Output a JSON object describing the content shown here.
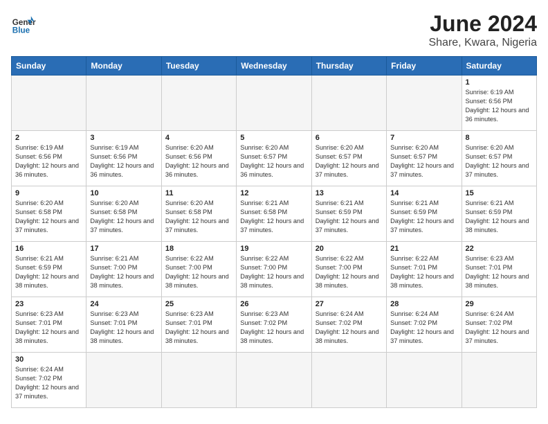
{
  "header": {
    "logo_general": "General",
    "logo_blue": "Blue",
    "title": "June 2024",
    "subtitle": "Share, Kwara, Nigeria"
  },
  "weekdays": [
    "Sunday",
    "Monday",
    "Tuesday",
    "Wednesday",
    "Thursday",
    "Friday",
    "Saturday"
  ],
  "weeks": [
    [
      {
        "day": "",
        "info": ""
      },
      {
        "day": "",
        "info": ""
      },
      {
        "day": "",
        "info": ""
      },
      {
        "day": "",
        "info": ""
      },
      {
        "day": "",
        "info": ""
      },
      {
        "day": "",
        "info": ""
      },
      {
        "day": "1",
        "info": "Sunrise: 6:19 AM\nSunset: 6:56 PM\nDaylight: 12 hours and 36 minutes."
      }
    ],
    [
      {
        "day": "2",
        "info": "Sunrise: 6:19 AM\nSunset: 6:56 PM\nDaylight: 12 hours and 36 minutes."
      },
      {
        "day": "3",
        "info": "Sunrise: 6:19 AM\nSunset: 6:56 PM\nDaylight: 12 hours and 36 minutes."
      },
      {
        "day": "4",
        "info": "Sunrise: 6:20 AM\nSunset: 6:56 PM\nDaylight: 12 hours and 36 minutes."
      },
      {
        "day": "5",
        "info": "Sunrise: 6:20 AM\nSunset: 6:57 PM\nDaylight: 12 hours and 36 minutes."
      },
      {
        "day": "6",
        "info": "Sunrise: 6:20 AM\nSunset: 6:57 PM\nDaylight: 12 hours and 37 minutes."
      },
      {
        "day": "7",
        "info": "Sunrise: 6:20 AM\nSunset: 6:57 PM\nDaylight: 12 hours and 37 minutes."
      },
      {
        "day": "8",
        "info": "Sunrise: 6:20 AM\nSunset: 6:57 PM\nDaylight: 12 hours and 37 minutes."
      }
    ],
    [
      {
        "day": "9",
        "info": "Sunrise: 6:20 AM\nSunset: 6:58 PM\nDaylight: 12 hours and 37 minutes."
      },
      {
        "day": "10",
        "info": "Sunrise: 6:20 AM\nSunset: 6:58 PM\nDaylight: 12 hours and 37 minutes."
      },
      {
        "day": "11",
        "info": "Sunrise: 6:20 AM\nSunset: 6:58 PM\nDaylight: 12 hours and 37 minutes."
      },
      {
        "day": "12",
        "info": "Sunrise: 6:21 AM\nSunset: 6:58 PM\nDaylight: 12 hours and 37 minutes."
      },
      {
        "day": "13",
        "info": "Sunrise: 6:21 AM\nSunset: 6:59 PM\nDaylight: 12 hours and 37 minutes."
      },
      {
        "day": "14",
        "info": "Sunrise: 6:21 AM\nSunset: 6:59 PM\nDaylight: 12 hours and 37 minutes."
      },
      {
        "day": "15",
        "info": "Sunrise: 6:21 AM\nSunset: 6:59 PM\nDaylight: 12 hours and 38 minutes."
      }
    ],
    [
      {
        "day": "16",
        "info": "Sunrise: 6:21 AM\nSunset: 6:59 PM\nDaylight: 12 hours and 38 minutes."
      },
      {
        "day": "17",
        "info": "Sunrise: 6:21 AM\nSunset: 7:00 PM\nDaylight: 12 hours and 38 minutes."
      },
      {
        "day": "18",
        "info": "Sunrise: 6:22 AM\nSunset: 7:00 PM\nDaylight: 12 hours and 38 minutes."
      },
      {
        "day": "19",
        "info": "Sunrise: 6:22 AM\nSunset: 7:00 PM\nDaylight: 12 hours and 38 minutes."
      },
      {
        "day": "20",
        "info": "Sunrise: 6:22 AM\nSunset: 7:00 PM\nDaylight: 12 hours and 38 minutes."
      },
      {
        "day": "21",
        "info": "Sunrise: 6:22 AM\nSunset: 7:01 PM\nDaylight: 12 hours and 38 minutes."
      },
      {
        "day": "22",
        "info": "Sunrise: 6:23 AM\nSunset: 7:01 PM\nDaylight: 12 hours and 38 minutes."
      }
    ],
    [
      {
        "day": "23",
        "info": "Sunrise: 6:23 AM\nSunset: 7:01 PM\nDaylight: 12 hours and 38 minutes."
      },
      {
        "day": "24",
        "info": "Sunrise: 6:23 AM\nSunset: 7:01 PM\nDaylight: 12 hours and 38 minutes."
      },
      {
        "day": "25",
        "info": "Sunrise: 6:23 AM\nSunset: 7:01 PM\nDaylight: 12 hours and 38 minutes."
      },
      {
        "day": "26",
        "info": "Sunrise: 6:23 AM\nSunset: 7:02 PM\nDaylight: 12 hours and 38 minutes."
      },
      {
        "day": "27",
        "info": "Sunrise: 6:24 AM\nSunset: 7:02 PM\nDaylight: 12 hours and 38 minutes."
      },
      {
        "day": "28",
        "info": "Sunrise: 6:24 AM\nSunset: 7:02 PM\nDaylight: 12 hours and 37 minutes."
      },
      {
        "day": "29",
        "info": "Sunrise: 6:24 AM\nSunset: 7:02 PM\nDaylight: 12 hours and 37 minutes."
      }
    ],
    [
      {
        "day": "30",
        "info": "Sunrise: 6:24 AM\nSunset: 7:02 PM\nDaylight: 12 hours and 37 minutes."
      },
      {
        "day": "",
        "info": ""
      },
      {
        "day": "",
        "info": ""
      },
      {
        "day": "",
        "info": ""
      },
      {
        "day": "",
        "info": ""
      },
      {
        "day": "",
        "info": ""
      },
      {
        "day": "",
        "info": ""
      }
    ]
  ]
}
